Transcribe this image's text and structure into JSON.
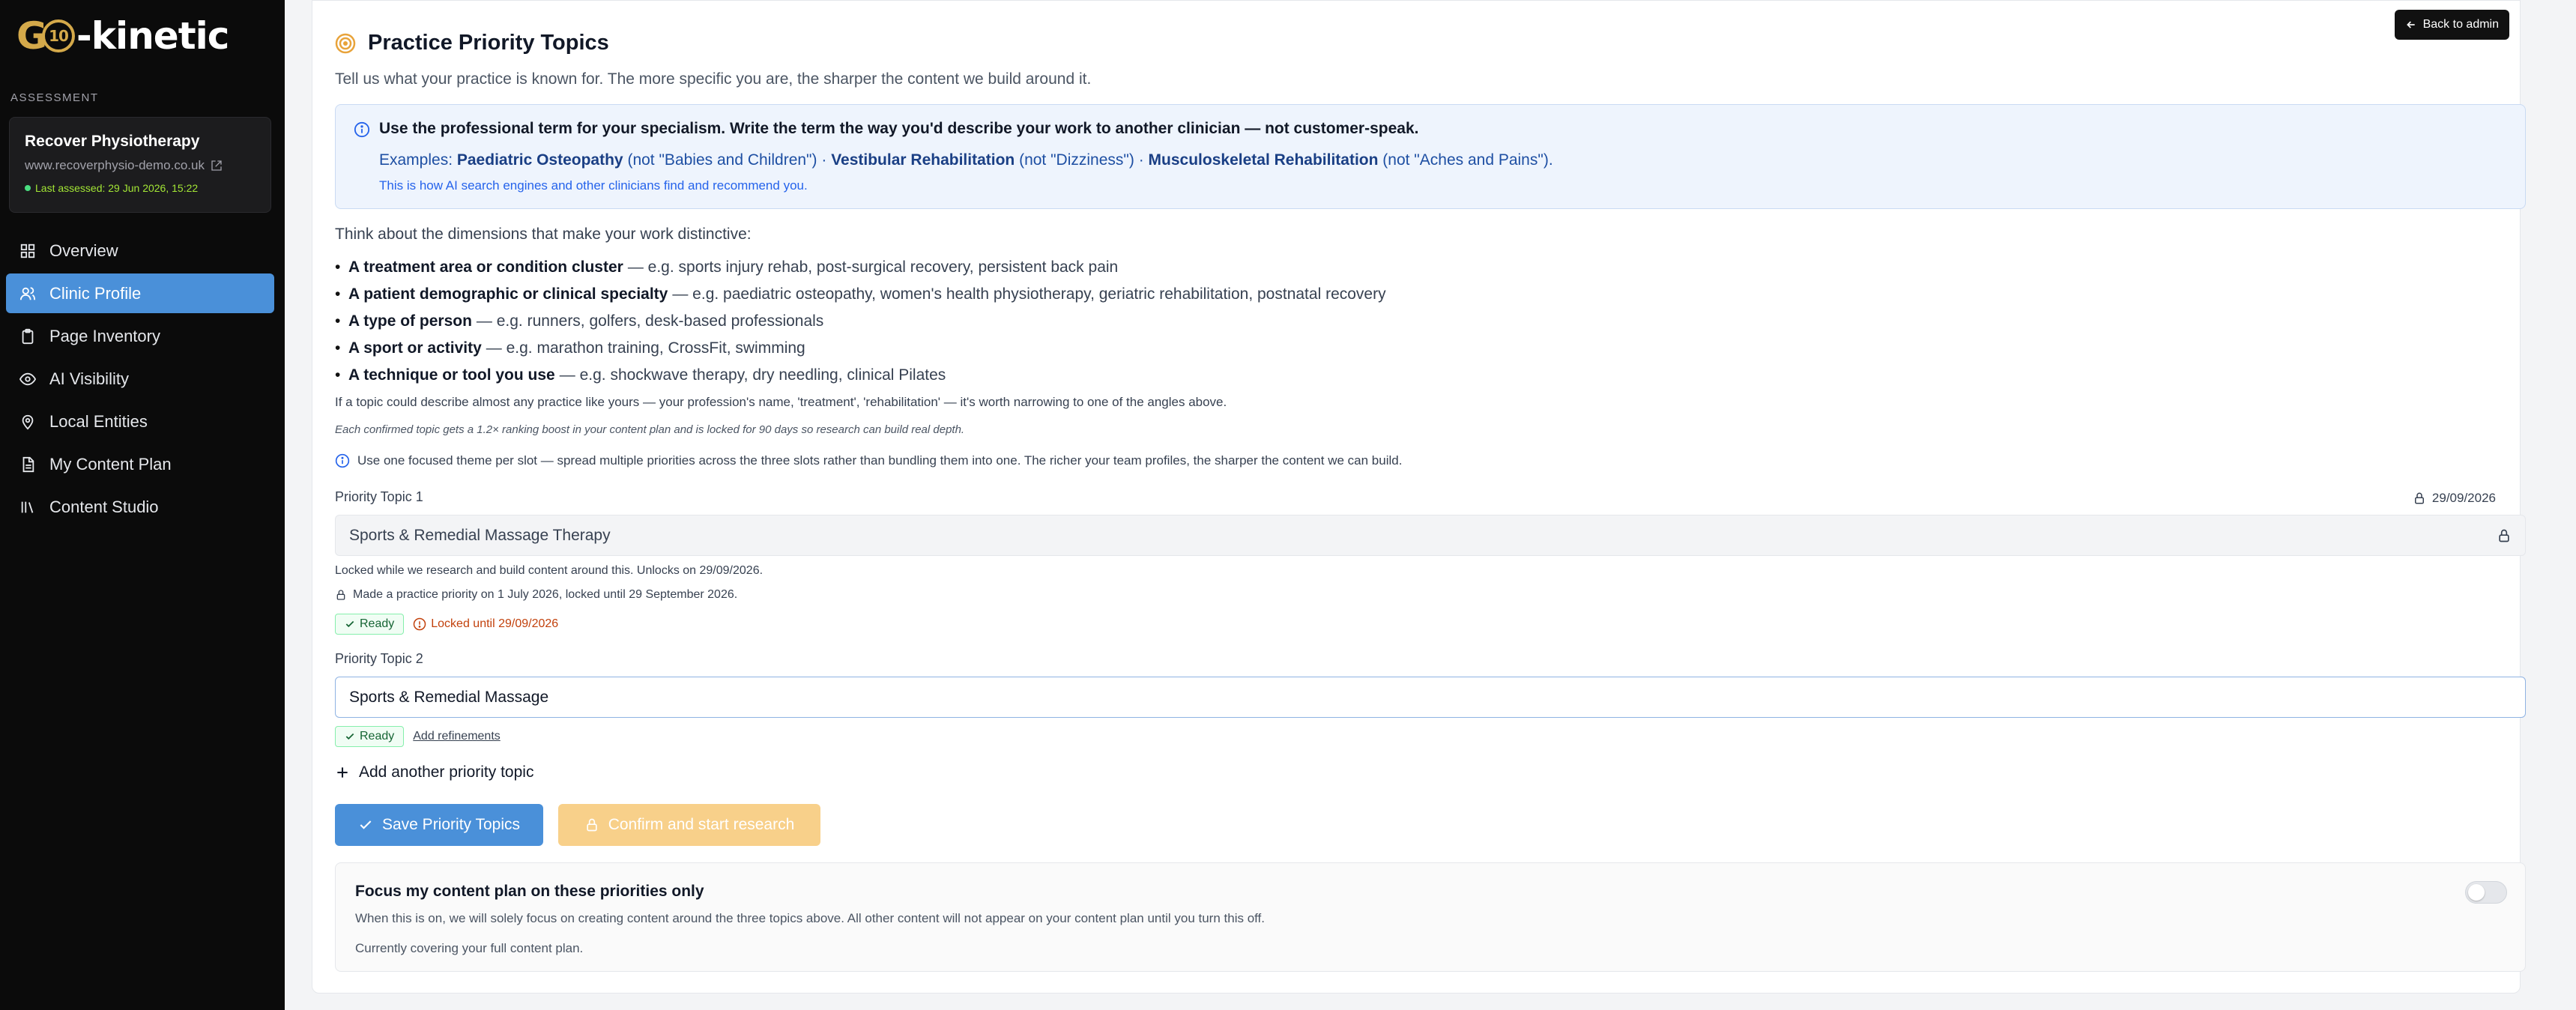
{
  "sidebar": {
    "logo_text": "-kinetic",
    "logo_badge": "10",
    "logo_prefix": "G",
    "section_label": "ASSESSMENT",
    "clinic": {
      "name": "Recover Physiotherapy",
      "url": "www.recoverphysio-demo.co.uk",
      "last_assessed": "Last assessed: 29 Jun 2026, 15:22"
    },
    "nav": [
      {
        "label": "Overview",
        "icon": "grid-icon",
        "active": false
      },
      {
        "label": "Clinic Profile",
        "icon": "users-icon",
        "active": true
      },
      {
        "label": "Page Inventory",
        "icon": "clipboard-icon",
        "active": false
      },
      {
        "label": "AI Visibility",
        "icon": "eye-icon",
        "active": false
      },
      {
        "label": "Local Entities",
        "icon": "map-pin-icon",
        "active": false
      },
      {
        "label": "My Content Plan",
        "icon": "document-icon",
        "active": false
      },
      {
        "label": "Content Studio",
        "icon": "library-icon",
        "active": false
      }
    ]
  },
  "header": {
    "back_button": "Back to admin",
    "title": "Practice Priority Topics",
    "subtitle": "Tell us what your practice is known for. The more specific you are, the sharper the content we build around it."
  },
  "info": {
    "heading": "Use the professional term for your specialism. Write the term the way you'd describe your work to another clinician — not customer-speak.",
    "examples_prefix": "Examples: ",
    "examples": [
      {
        "term": "Paediatric Osteopathy",
        "not": " (not \"Babies and Children\")"
      },
      {
        "term": "Vestibular Rehabilitation",
        "not": " (not \"Dizziness\")"
      },
      {
        "term": "Musculoskeletal Rehabilitation",
        "not": " (not \"Aches and Pains\")."
      }
    ],
    "separator": " · ",
    "sub": "This is how AI search engines and other clinicians find and recommend you."
  },
  "guidance": {
    "intro": "Think about the dimensions that make your work distinctive:",
    "bullets": [
      {
        "bold": "A treatment area or condition cluster",
        "rest": "— e.g. sports injury rehab, post-surgical recovery, persistent back pain"
      },
      {
        "bold": "A patient demographic or clinical specialty",
        "rest": "— e.g. paediatric osteopathy, women's health physiotherapy, geriatric rehabilitation, postnatal recovery"
      },
      {
        "bold": "A type of person",
        "rest": "— e.g. runners, golfers, desk-based professionals"
      },
      {
        "bold": "A sport or activity",
        "rest": "— e.g. marathon training, CrossFit, swimming"
      },
      {
        "bold": "A technique or tool you use",
        "rest": "— e.g. shockwave therapy, dry needling, clinical Pilates"
      }
    ],
    "note1": "If a topic could describe almost any practice like yours — your profession's name, 'treatment', 'rehabilitation' — it's worth narrowing to one of the angles above.",
    "note2": "Each confirmed topic gets a 1.2× ranking boost in your content plan and is locked for 90 days so research can build real depth.",
    "note3": "Use one focused theme per slot — spread multiple priorities across the three slots rather than bundling them into one. The richer your team profiles, the sharper the content we can build."
  },
  "topic1": {
    "label": "Priority Topic 1",
    "lock_date": "29/09/2026",
    "value": "Sports & Remedial Massage Therapy",
    "locked_msg": "Locked while we research and build content around this. Unlocks on 29/09/2026.",
    "made_msg": "Made a practice priority on 1 July 2026, locked until 29 September 2026.",
    "ready": "Ready",
    "locked_until": "Locked until 29/09/2026"
  },
  "topic2": {
    "label": "Priority Topic 2",
    "value": "Sports & Remedial Massage",
    "ready": "Ready",
    "refine": "Add refinements"
  },
  "actions": {
    "add_topic": "Add another priority topic",
    "save": "Save Priority Topics",
    "confirm": "Confirm and start research"
  },
  "focus": {
    "title": "Focus my content plan on these priorities only",
    "desc": "When this is on, we will solely focus on creating content around the three topics above. All other content will not appear on your content plan until you turn this off.",
    "status": "Currently covering your full content plan.",
    "enabled": false
  },
  "colors": {
    "sidebar_bg": "#0b0b0b",
    "accent": "#4a90d9",
    "gold": "#d4a94a",
    "confirm_disabled": "#f8d08a",
    "info_bg": "#eef4fd"
  }
}
